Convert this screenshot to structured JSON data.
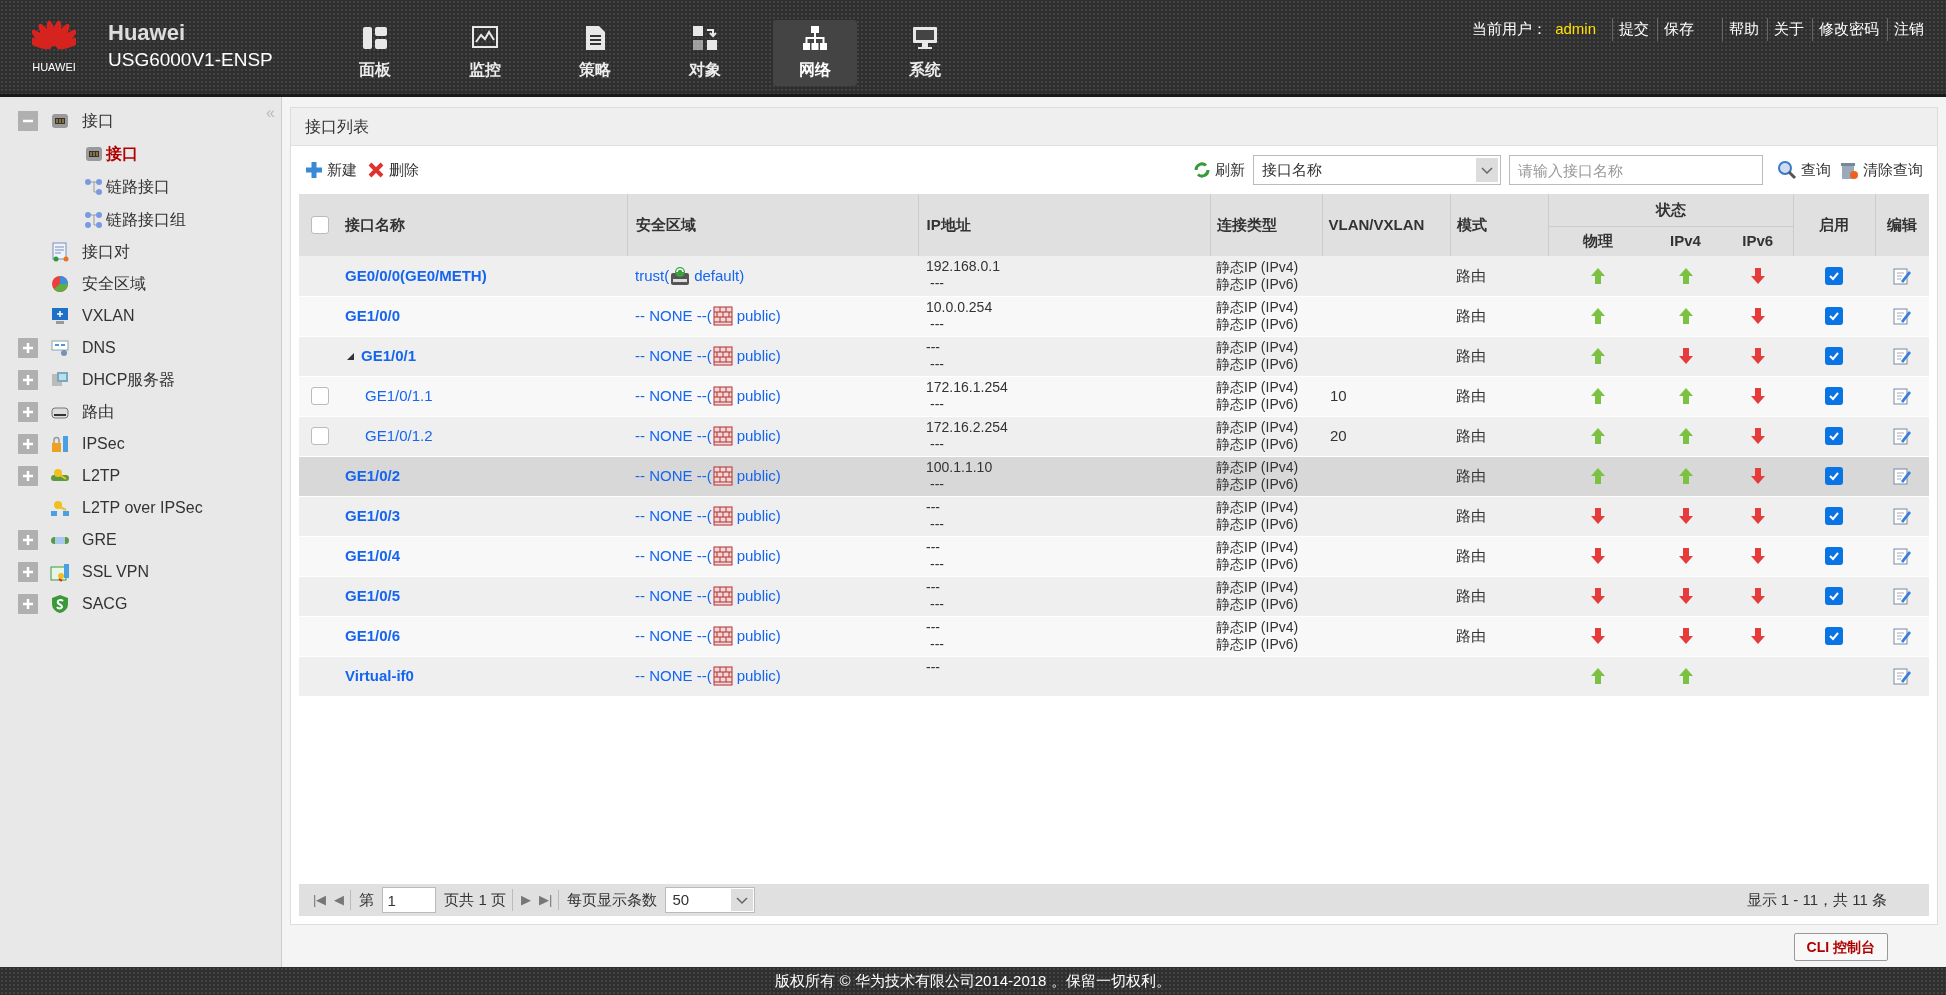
{
  "header": {
    "brand": "Huawei",
    "logo_text": "HUAWEI",
    "model": "USG6000V1-ENSP",
    "nav": [
      {
        "label": "面板",
        "selected": false
      },
      {
        "label": "监控",
        "selected": false
      },
      {
        "label": "策略",
        "selected": false
      },
      {
        "label": "对象",
        "selected": false
      },
      {
        "label": "网络",
        "selected": true
      },
      {
        "label": "系统",
        "selected": false
      }
    ],
    "user_label": "当前用户：",
    "user": "admin",
    "actions": [
      "提交",
      "保存"
    ],
    "links": [
      "帮助",
      "关于",
      "修改密码",
      "注销"
    ]
  },
  "sidebar": {
    "collapse": "«",
    "items": [
      {
        "label": "接口",
        "expanded": true,
        "children": [
          {
            "label": "接口",
            "selected": true
          },
          {
            "label": "链路接口",
            "selected": false
          },
          {
            "label": "链路接口组",
            "selected": false
          }
        ]
      },
      {
        "label": "接口对"
      },
      {
        "label": "安全区域"
      },
      {
        "label": "VXLAN"
      },
      {
        "label": "DNS",
        "expanded": false
      },
      {
        "label": "DHCP服务器",
        "expanded": false
      },
      {
        "label": "路由",
        "expanded": false
      },
      {
        "label": "IPSec",
        "expanded": false
      },
      {
        "label": "L2TP",
        "expanded": false
      },
      {
        "label": "L2TP over IPSec"
      },
      {
        "label": "GRE",
        "expanded": false
      },
      {
        "label": "SSL VPN",
        "expanded": false
      },
      {
        "label": "SACG",
        "expanded": false
      }
    ]
  },
  "panel": {
    "title": "接口列表",
    "toolbar": {
      "new": "新建",
      "delete": "删除",
      "refresh": "刷新",
      "filter_select": "接口名称",
      "search": {
        "placeholder": "请输入接口名称"
      },
      "query": "查询",
      "clear": "清除查询"
    },
    "table": {
      "header_checked": false,
      "columns": {
        "name": "接口名称",
        "zone": "安全区域",
        "ip": "IP地址",
        "conn": "连接类型",
        "vlan": "VLAN/VXLAN",
        "mode": "模式",
        "status": "状态",
        "phys": "物理",
        "ipv4": "IPv4",
        "ipv6": "IPv6",
        "enable": "启用",
        "edit": "编辑"
      },
      "rows": [
        {
          "name": "GE0/0/0(GE0/METH)",
          "selected": false,
          "zone": "trust(",
          "zone_assigned": true,
          "vsys": "default)",
          "ip": [
            "192.168.0.1",
            "---"
          ],
          "conn": [
            "静态IP (IPv4)",
            "静态IP (IPv6)"
          ],
          "mode": "路由",
          "phys_up": true,
          "ipv4_up": true,
          "ipv6_up": false,
          "enabled": true
        },
        {
          "name": "GE1/0/0",
          "selected": false,
          "zone": "-- NONE --(",
          "zone_assigned": false,
          "vsys": "public)",
          "ip": [
            "10.0.0.254",
            "---"
          ],
          "conn": [
            "静态IP (IPv4)",
            "静态IP (IPv6)"
          ],
          "mode": "路由",
          "phys_up": true,
          "ipv4_up": true,
          "ipv6_up": false,
          "enabled": true
        },
        {
          "name": "GE1/0/1",
          "selected": false,
          "expanded": true,
          "zone": "-- NONE --(",
          "zone_assigned": false,
          "vsys": "public)",
          "ip": [
            "---",
            "---"
          ],
          "conn": [
            "静态IP (IPv4)",
            "静态IP (IPv6)"
          ],
          "mode": "路由",
          "phys_up": true,
          "ipv4_up": false,
          "ipv6_up": false,
          "enabled": true,
          "children": [
            {
              "name": "GE1/0/1.1",
              "selected": false,
              "checked": false,
              "zone": "-- NONE --(",
              "zone_assigned": false,
              "vsys": "public)",
              "ip": [
                "172.16.1.254",
                "---"
              ],
              "conn": [
                "静态IP (IPv4)",
                "静态IP (IPv6)"
              ],
              "vlan": "10",
              "mode": "路由",
              "phys_up": true,
              "ipv4_up": true,
              "ipv6_up": false,
              "enabled": true
            },
            {
              "name": "GE1/0/1.2",
              "selected": false,
              "checked": false,
              "zone": "-- NONE --(",
              "zone_assigned": false,
              "vsys": "public)",
              "ip": [
                "172.16.2.254",
                "---"
              ],
              "conn": [
                "静态IP (IPv4)",
                "静态IP (IPv6)"
              ],
              "vlan": "20",
              "mode": "路由",
              "phys_up": true,
              "ipv4_up": true,
              "ipv6_up": false,
              "enabled": true
            }
          ]
        },
        {
          "name": "GE1/0/2",
          "selected": true,
          "zone": "-- NONE --(",
          "zone_assigned": false,
          "vsys": "public)",
          "ip": [
            "100.1.1.10",
            "---"
          ],
          "conn": [
            "静态IP (IPv4)",
            "静态IP (IPv6)"
          ],
          "mode": "路由",
          "phys_up": true,
          "ipv4_up": true,
          "ipv6_up": false,
          "enabled": true
        },
        {
          "name": "GE1/0/3",
          "selected": false,
          "zone": "-- NONE --(",
          "zone_assigned": false,
          "vsys": "public)",
          "ip": [
            "---",
            "---"
          ],
          "conn": [
            "静态IP (IPv4)",
            "静态IP (IPv6)"
          ],
          "mode": "路由",
          "phys_up": false,
          "ipv4_up": false,
          "ipv6_up": false,
          "enabled": true
        },
        {
          "name": "GE1/0/4",
          "selected": false,
          "zone": "-- NONE --(",
          "zone_assigned": false,
          "vsys": "public)",
          "ip": [
            "---",
            "---"
          ],
          "conn": [
            "静态IP (IPv4)",
            "静态IP (IPv6)"
          ],
          "mode": "路由",
          "phys_up": false,
          "ipv4_up": false,
          "ipv6_up": false,
          "enabled": true
        },
        {
          "name": "GE1/0/5",
          "selected": false,
          "zone": "-- NONE --(",
          "zone_assigned": false,
          "vsys": "public)",
          "ip": [
            "---",
            "---"
          ],
          "conn": [
            "静态IP (IPv4)",
            "静态IP (IPv6)"
          ],
          "mode": "路由",
          "phys_up": false,
          "ipv4_up": false,
          "ipv6_up": false,
          "enabled": true
        },
        {
          "name": "GE1/0/6",
          "selected": false,
          "zone": "-- NONE --(",
          "zone_assigned": false,
          "vsys": "public)",
          "ip": [
            "---",
            "---"
          ],
          "conn": [
            "静态IP (IPv4)",
            "静态IP (IPv6)"
          ],
          "mode": "路由",
          "phys_up": false,
          "ipv4_up": false,
          "ipv6_up": false,
          "enabled": true
        },
        {
          "name": "Virtual-if0",
          "selected": false,
          "zone": "-- NONE --(",
          "zone_assigned": false,
          "vsys": "public)",
          "ip": [
            "---"
          ],
          "phys_up": true,
          "ipv4_up": true
        }
      ]
    },
    "pager": {
      "first": "|◀",
      "prev": "◀",
      "page_label": "第",
      "page": "1",
      "total": "页共 1 页",
      "next": "▶",
      "last": "▶|",
      "per_page_label": "每页显示条数",
      "per_page": "50",
      "summary": "显示 1 - 11，共 11 条"
    }
  },
  "cli_button": "CLI 控制台",
  "footer": "版权所有 © 华为技术有限公司2014-2018 。保留一切权利。"
}
